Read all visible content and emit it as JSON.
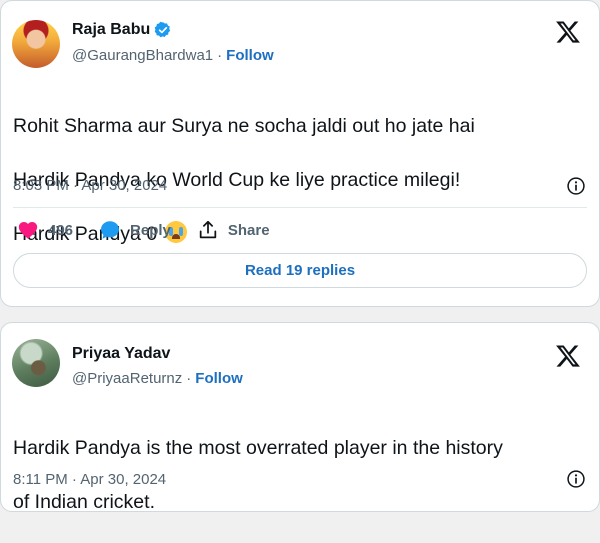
{
  "colors": {
    "link": "#1d6fc0",
    "verified": "#1d9bf0",
    "like_heart": "#f91880",
    "reply_bubble": "#1d9bf0",
    "muted_text": "#536471",
    "border": "#cfd9de"
  },
  "tweets": [
    {
      "display_name": "Raja Babu",
      "verified": true,
      "handle": "@GaurangBhardwa1",
      "separator": "·",
      "follow_label": "Follow",
      "text_lines": [
        "Rohit Sharma aur Surya ne socha jaldi out ho jate hai",
        "Hardik Pandya ko World Cup ke liye practice milegi!",
        "Hardik Pandya 0"
      ],
      "emoji": "loudly-crying-face",
      "timestamp": "8:03 PM · Apr 30, 2024",
      "likes": "496",
      "reply_label": "Reply",
      "share_label": "Share",
      "read_replies_label": "Read 19 replies",
      "icons": [
        "verified-badge-icon",
        "x-logo-icon",
        "info-icon",
        "heart-icon",
        "reply-bubble-icon",
        "share-icon"
      ]
    },
    {
      "display_name": "Priyaa Yadav",
      "verified": false,
      "handle": "@PriyaaReturnz",
      "separator": "·",
      "follow_label": "Follow",
      "text_lines": [
        "Hardik Pandya is the most overrated player in the history",
        "of Indian cricket."
      ],
      "timestamp": "8:11 PM · Apr 30, 2024",
      "icons": [
        "x-logo-icon",
        "info-icon"
      ]
    }
  ]
}
